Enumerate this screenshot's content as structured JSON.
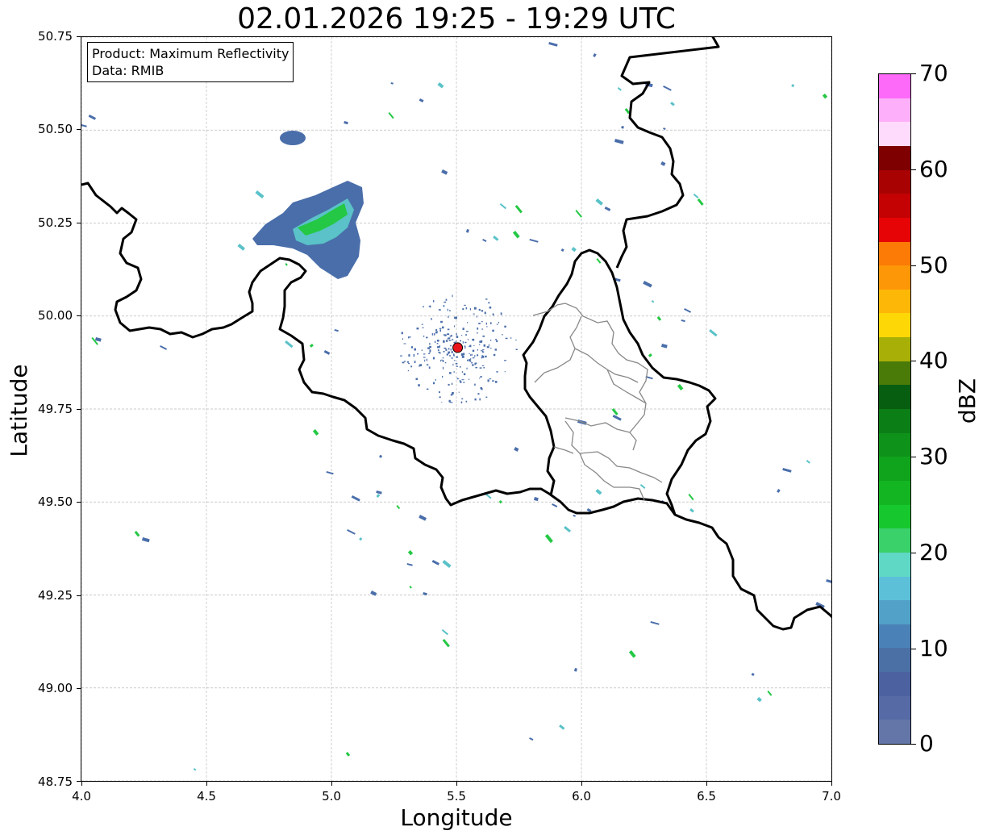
{
  "title": "02.01.2026 19:25 - 19:29 UTC",
  "legend": {
    "product": "Product: Maximum Reflectivity",
    "data": "Data: RMIB"
  },
  "axes": {
    "xlabel": "Longitude",
    "ylabel": "Latitude",
    "xlim": [
      4.0,
      7.0
    ],
    "ylim": [
      48.75,
      50.75
    ],
    "xticks": [
      "4.0",
      "4.5",
      "5.0",
      "5.5",
      "6.0",
      "6.5",
      "7.0"
    ],
    "yticks": [
      "50.75",
      "50.50",
      "50.25",
      "50.00",
      "49.75",
      "49.50",
      "49.25",
      "49.00",
      "48.75"
    ],
    "grid": "dashed light grey"
  },
  "radar_site": {
    "lon": 5.505,
    "lat": 49.915,
    "color": "#e8141c"
  },
  "colorbar": {
    "label": "dBZ",
    "ticks": [
      "0",
      "10",
      "20",
      "30",
      "40",
      "50",
      "60",
      "70"
    ],
    "range": [
      0,
      70
    ],
    "step": 2.5,
    "colors": [
      "#6475a8",
      "#566aa5",
      "#4c62a0",
      "#4b70a6",
      "#4a81b6",
      "#51a1c8",
      "#5cc0d9",
      "#5fd8c6",
      "#3ad16b",
      "#16c82e",
      "#13b622",
      "#10a41d",
      "#0e921a",
      "#0b7e16",
      "#085e10",
      "#4a7a08",
      "#a8b007",
      "#fed707",
      "#fdb807",
      "#fd9707",
      "#fc7a06",
      "#e60406",
      "#c40203",
      "#a90202",
      "#7f0000",
      "#fedbfc",
      "#fdaffa",
      "#fd6af9",
      "#f43aee"
    ]
  },
  "echo_colors": {
    "weak": "#4a6eaa",
    "moderate": "#5ac2c8",
    "strong": "#24c844"
  }
}
